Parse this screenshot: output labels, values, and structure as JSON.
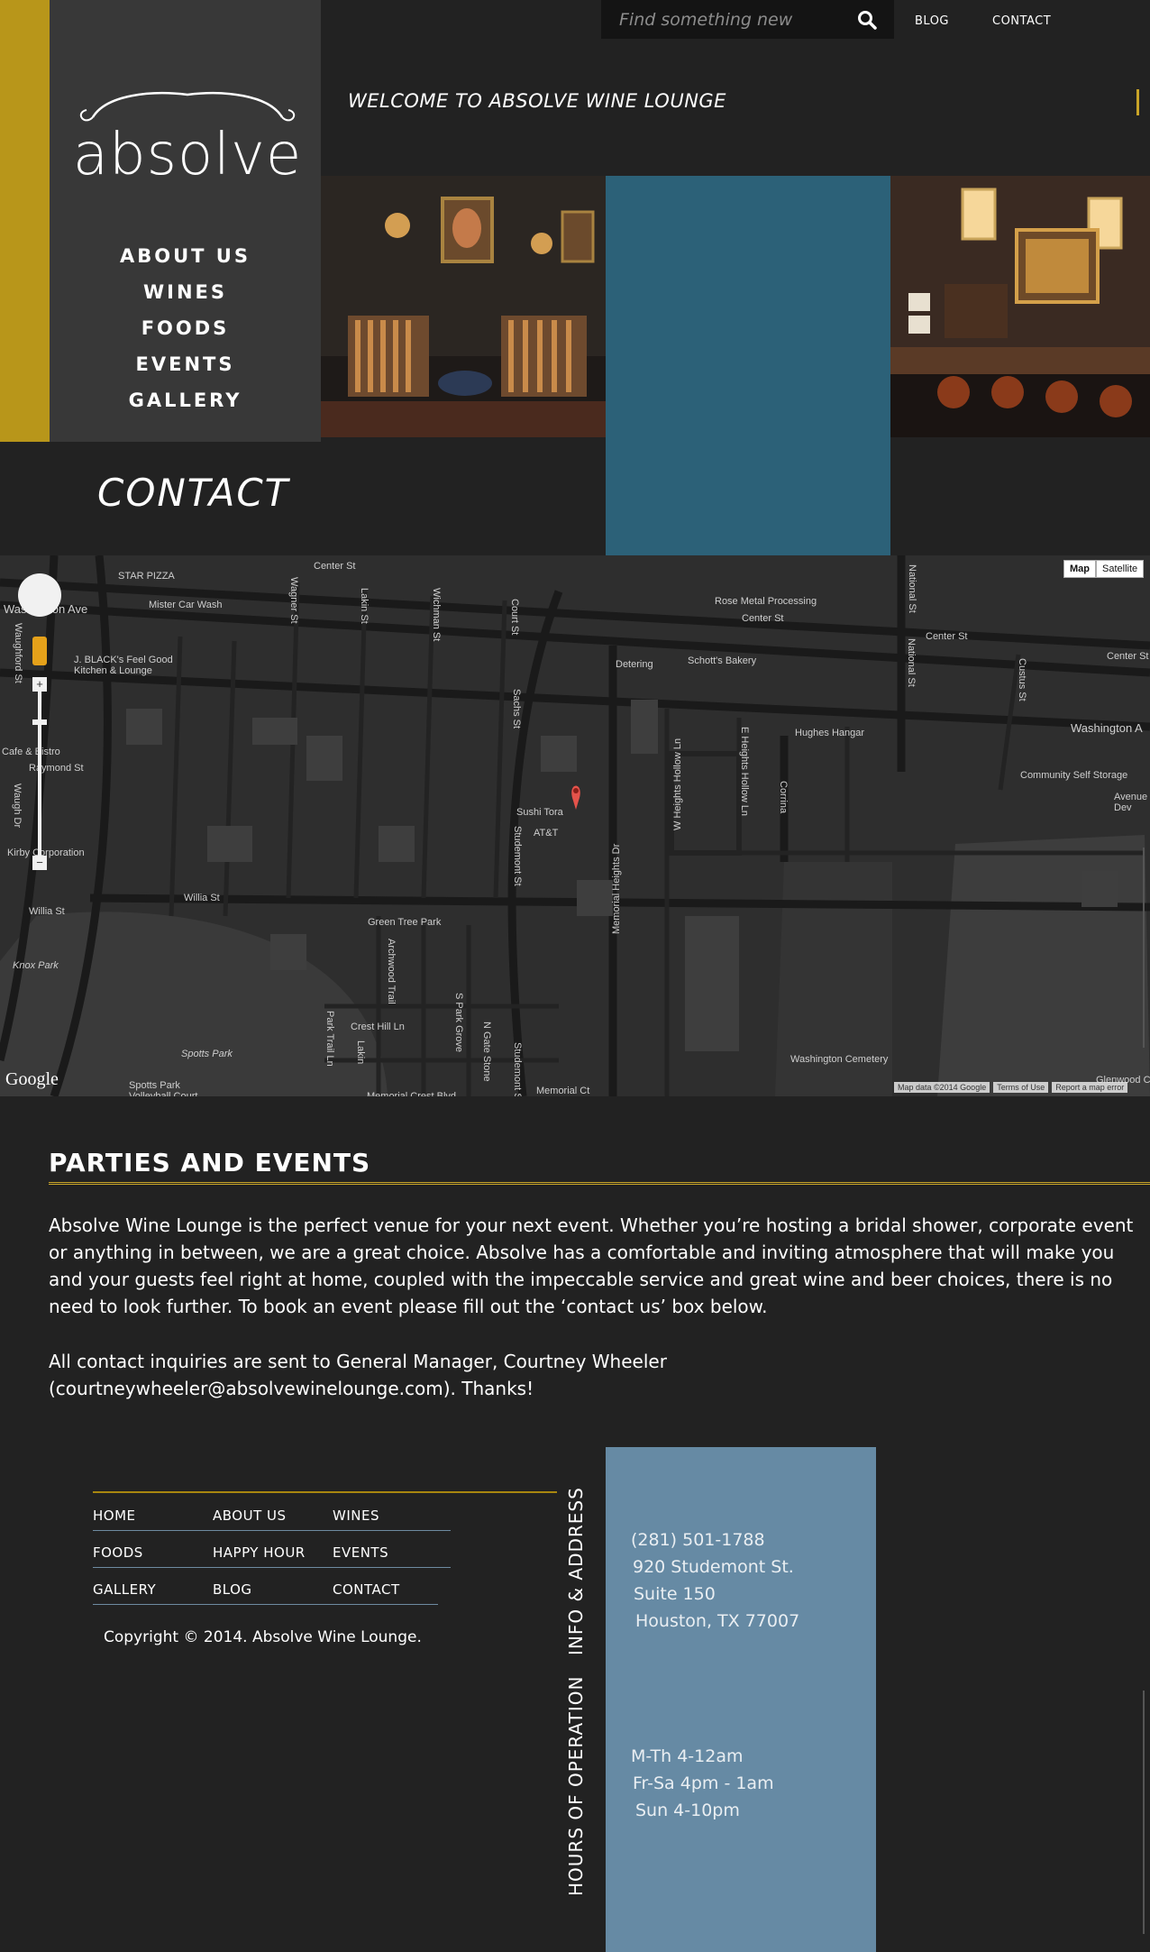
{
  "brand": {
    "logo_text": "absolve"
  },
  "side_nav": [
    "ABOUT US",
    "WINES",
    "FOODS",
    "EVENTS",
    "GALLERY"
  ],
  "header": {
    "search_placeholder": "Find something new",
    "links": [
      "BLOG",
      "CONTACT"
    ],
    "welcome": "WELCOME TO ABSOLVE WINE LOUNGE"
  },
  "page_title": "CONTACT",
  "map": {
    "type_buttons": [
      "Map",
      "Satellite"
    ],
    "active_type": "Map",
    "logo": "Google",
    "attribution": [
      "Map data ©2014 Google",
      "Terms of Use",
      "Report a map error"
    ],
    "labels": [
      "Center St",
      "STAR PIZZA",
      "Mister Car Wash",
      "Washington Ave",
      "J. BLACK's Feel Good Kitchen & Lounge",
      "Rose Metal Processing",
      "Detering",
      "Schott's Bakery",
      "Hughes Hangar",
      "Community Self Storage",
      "Avenue Dev",
      "Cafe & Bistro",
      "Raymond St",
      "Kirby Corporation",
      "Willia St",
      "Knox Park",
      "Green Tree Park",
      "Spotts Park",
      "Spotts Park Volleyball Court",
      "Crest Hill Ln",
      "Memorial Crest Blvd",
      "Memorial Ct",
      "Washington Cemetery",
      "Glenwood C",
      "Sushi Tora",
      "AT&T",
      "Wagner St",
      "Lakin St",
      "Wichman St",
      "Court St",
      "Sachs St",
      "National St",
      "Custus St",
      "Studemont St",
      "Memorial Heights Dr",
      "W Heights Hollow Ln",
      "E Heights Hollow Ln",
      "Corrina",
      "Waughford St",
      "Waugh Dr",
      "Archwood Trail",
      "Park Trail Ln",
      "Lakin",
      "S Park Grove",
      "N Gate Stone",
      "Washington A"
    ]
  },
  "parties": {
    "title": "PARTIES AND EVENTS",
    "body": "Absolve Wine Lounge is the perfect venue for your next event. Whether you’re hosting a bridal shower, corporate event or anything in between, we are a great choice. Absolve has a comfortable and inviting atmosphere that will make you and your guests feel right at home, coupled with the impeccable service and great wine and beer choices, there is no need to look further. To book an event please fill out the ‘contact us’ box below.",
    "note_line1": "All contact inquiries are sent to General Manager, Courtney Wheeler",
    "note_line2": "(courtneywheeler@absolvewinelounge.com). Thanks!"
  },
  "footer": {
    "nav": [
      [
        "HOME",
        "ABOUT US",
        "WINES"
      ],
      [
        "FOODS",
        "HAPPY HOUR",
        "EVENTS"
      ],
      [
        "GALLERY",
        "BLOG",
        "CONTACT"
      ]
    ],
    "copyright": "Copyright © 2014. Absolve Wine Lounge.",
    "info_label": "INFO & ADDRESS",
    "hours_label": "HOURS OF OPERATION",
    "info": [
      "(281) 501-1788",
      "920 Studemont St.",
      "Suite 150",
      "Houston, TX 77007"
    ],
    "hours": [
      "M-Th 4-12am",
      "Fr-Sa 4pm - 1am",
      "Sun 4-10pm"
    ]
  },
  "colors": {
    "gold": "#b8961a",
    "teal_block": "#2c6178",
    "info_block": "#668aa4",
    "background": "#222222"
  }
}
